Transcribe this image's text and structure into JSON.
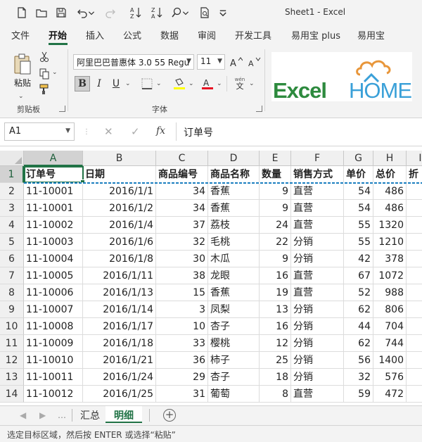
{
  "window": {
    "title": "Sheet1  -  Excel"
  },
  "ribbon_tabs": [
    "文件",
    "开始",
    "插入",
    "公式",
    "数据",
    "审阅",
    "开发工具",
    "易用宝 plus",
    "易用宝"
  ],
  "active_tab": "开始",
  "clipboard": {
    "paste_label": "粘贴",
    "group_label": "剪贴板"
  },
  "font": {
    "name": "阿里巴巴普惠体 3.0 55 Regu",
    "size": "11",
    "group_label": "字体",
    "wen_label": "wén",
    "wen_char": "文"
  },
  "logo": {
    "excel": "Excel",
    "home": "HOME"
  },
  "formula_bar": {
    "name_box": "A1",
    "formula": "订单号"
  },
  "columns": [
    "A",
    "B",
    "C",
    "D",
    "E",
    "F",
    "G",
    "H",
    "I"
  ],
  "table": {
    "headers": [
      "订单号",
      "日期",
      "商品编号",
      "商品名称",
      "数量",
      "销售方式",
      "单价",
      "总价",
      "折"
    ],
    "rows": [
      [
        "11-10001",
        "2016/1/1",
        "34",
        "香蕉",
        "9",
        "直营",
        "54",
        "486"
      ],
      [
        "11-10001",
        "2016/1/2",
        "34",
        "香蕉",
        "9",
        "直营",
        "54",
        "486"
      ],
      [
        "11-10002",
        "2016/1/4",
        "37",
        "荔枝",
        "24",
        "直营",
        "55",
        "1320"
      ],
      [
        "11-10003",
        "2016/1/6",
        "32",
        "毛桃",
        "22",
        "分销",
        "55",
        "1210"
      ],
      [
        "11-10004",
        "2016/1/8",
        "30",
        "木瓜",
        "9",
        "分销",
        "42",
        "378"
      ],
      [
        "11-10005",
        "2016/1/11",
        "38",
        "龙眼",
        "16",
        "直营",
        "67",
        "1072"
      ],
      [
        "11-10006",
        "2016/1/13",
        "15",
        "香蕉",
        "19",
        "直营",
        "52",
        "988"
      ],
      [
        "11-10007",
        "2016/1/14",
        "3",
        "凤梨",
        "13",
        "分销",
        "62",
        "806"
      ],
      [
        "11-10008",
        "2016/1/17",
        "10",
        "杏子",
        "16",
        "分销",
        "44",
        "704"
      ],
      [
        "11-10009",
        "2016/1/18",
        "33",
        "樱桃",
        "12",
        "分销",
        "62",
        "744"
      ],
      [
        "11-10010",
        "2016/1/21",
        "36",
        "柿子",
        "25",
        "分销",
        "56",
        "1400"
      ],
      [
        "11-10011",
        "2016/1/24",
        "29",
        "杏子",
        "18",
        "分销",
        "32",
        "576"
      ],
      [
        "11-10012",
        "2016/1/25",
        "31",
        "葡萄",
        "8",
        "直营",
        "59",
        "472"
      ]
    ]
  },
  "row_numbers": [
    "1",
    "2",
    "3",
    "4",
    "5",
    "6",
    "7",
    "8",
    "9",
    "10",
    "11",
    "12",
    "13",
    "14"
  ],
  "sheets": [
    "汇总",
    "明细"
  ],
  "active_sheet": "明细",
  "status": {
    "message": "选定目标区域，然后按 ENTER 或选择“粘贴”"
  },
  "colors": {
    "accent": "#217346",
    "logo_green": "#2d8a3e",
    "logo_blue": "#3aa0d8"
  }
}
